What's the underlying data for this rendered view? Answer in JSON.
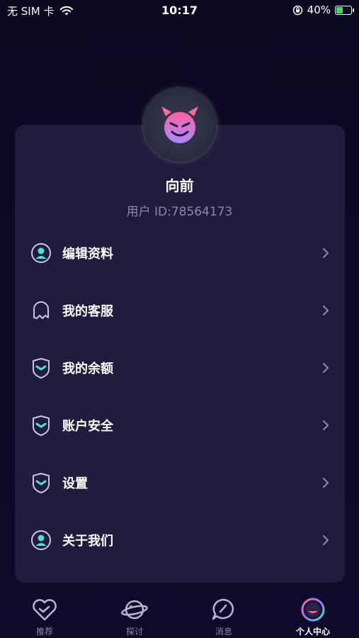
{
  "status_bar": {
    "carrier": "无 SIM 卡",
    "time": "10:17",
    "battery": "40%",
    "battery_level": 0.4
  },
  "profile": {
    "name": "向前",
    "user_id": "用户 ID:78564173"
  },
  "menu": [
    {
      "label": "编辑资料",
      "icon": "user-circle-icon"
    },
    {
      "label": "我的客服",
      "icon": "ghost-bell-icon"
    },
    {
      "label": "我的余额",
      "icon": "shield-icon"
    },
    {
      "label": "账户安全",
      "icon": "shield-icon"
    },
    {
      "label": "设置",
      "icon": "shield-icon"
    },
    {
      "label": "关于我们",
      "icon": "user-circle-icon"
    }
  ],
  "tabs": [
    {
      "label": "推荐",
      "icon": "heart-icon",
      "active": false
    },
    {
      "label": "探讨",
      "icon": "planet-icon",
      "active": false
    },
    {
      "label": "消息",
      "icon": "chat-bubble-icon",
      "active": false
    },
    {
      "label": "个人中心",
      "icon": "profile-orb-icon",
      "active": true
    }
  ],
  "colors": {
    "background": "#0c0a24",
    "card": "#1f1c3d",
    "accent_teal": "#4fe0d2",
    "accent_pink": "#ff5fa8",
    "accent_purple": "#8f7bff"
  }
}
